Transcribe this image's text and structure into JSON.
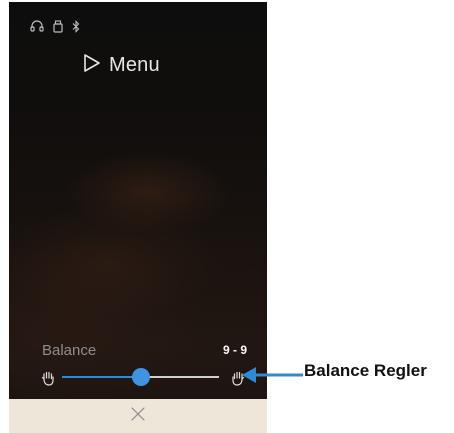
{
  "status_bar": {
    "icons": [
      "headphones-icon",
      "usb-icon",
      "bluetooth-icon"
    ]
  },
  "header": {
    "menu_label": "Menu",
    "menu_icon": "play-outline-icon"
  },
  "balance": {
    "label": "Balance",
    "value": "9 - 9",
    "position": 0.5,
    "left_icon": "hand-left-icon",
    "right_icon": "hand-right-icon"
  },
  "bottom_bar": {
    "close_icon": "close-icon"
  },
  "callout": {
    "label": "Balance Regler"
  },
  "colors": {
    "accent": "#3f94e2",
    "callout": "#2e8ad8",
    "bottom_bar": "#efe6da"
  }
}
